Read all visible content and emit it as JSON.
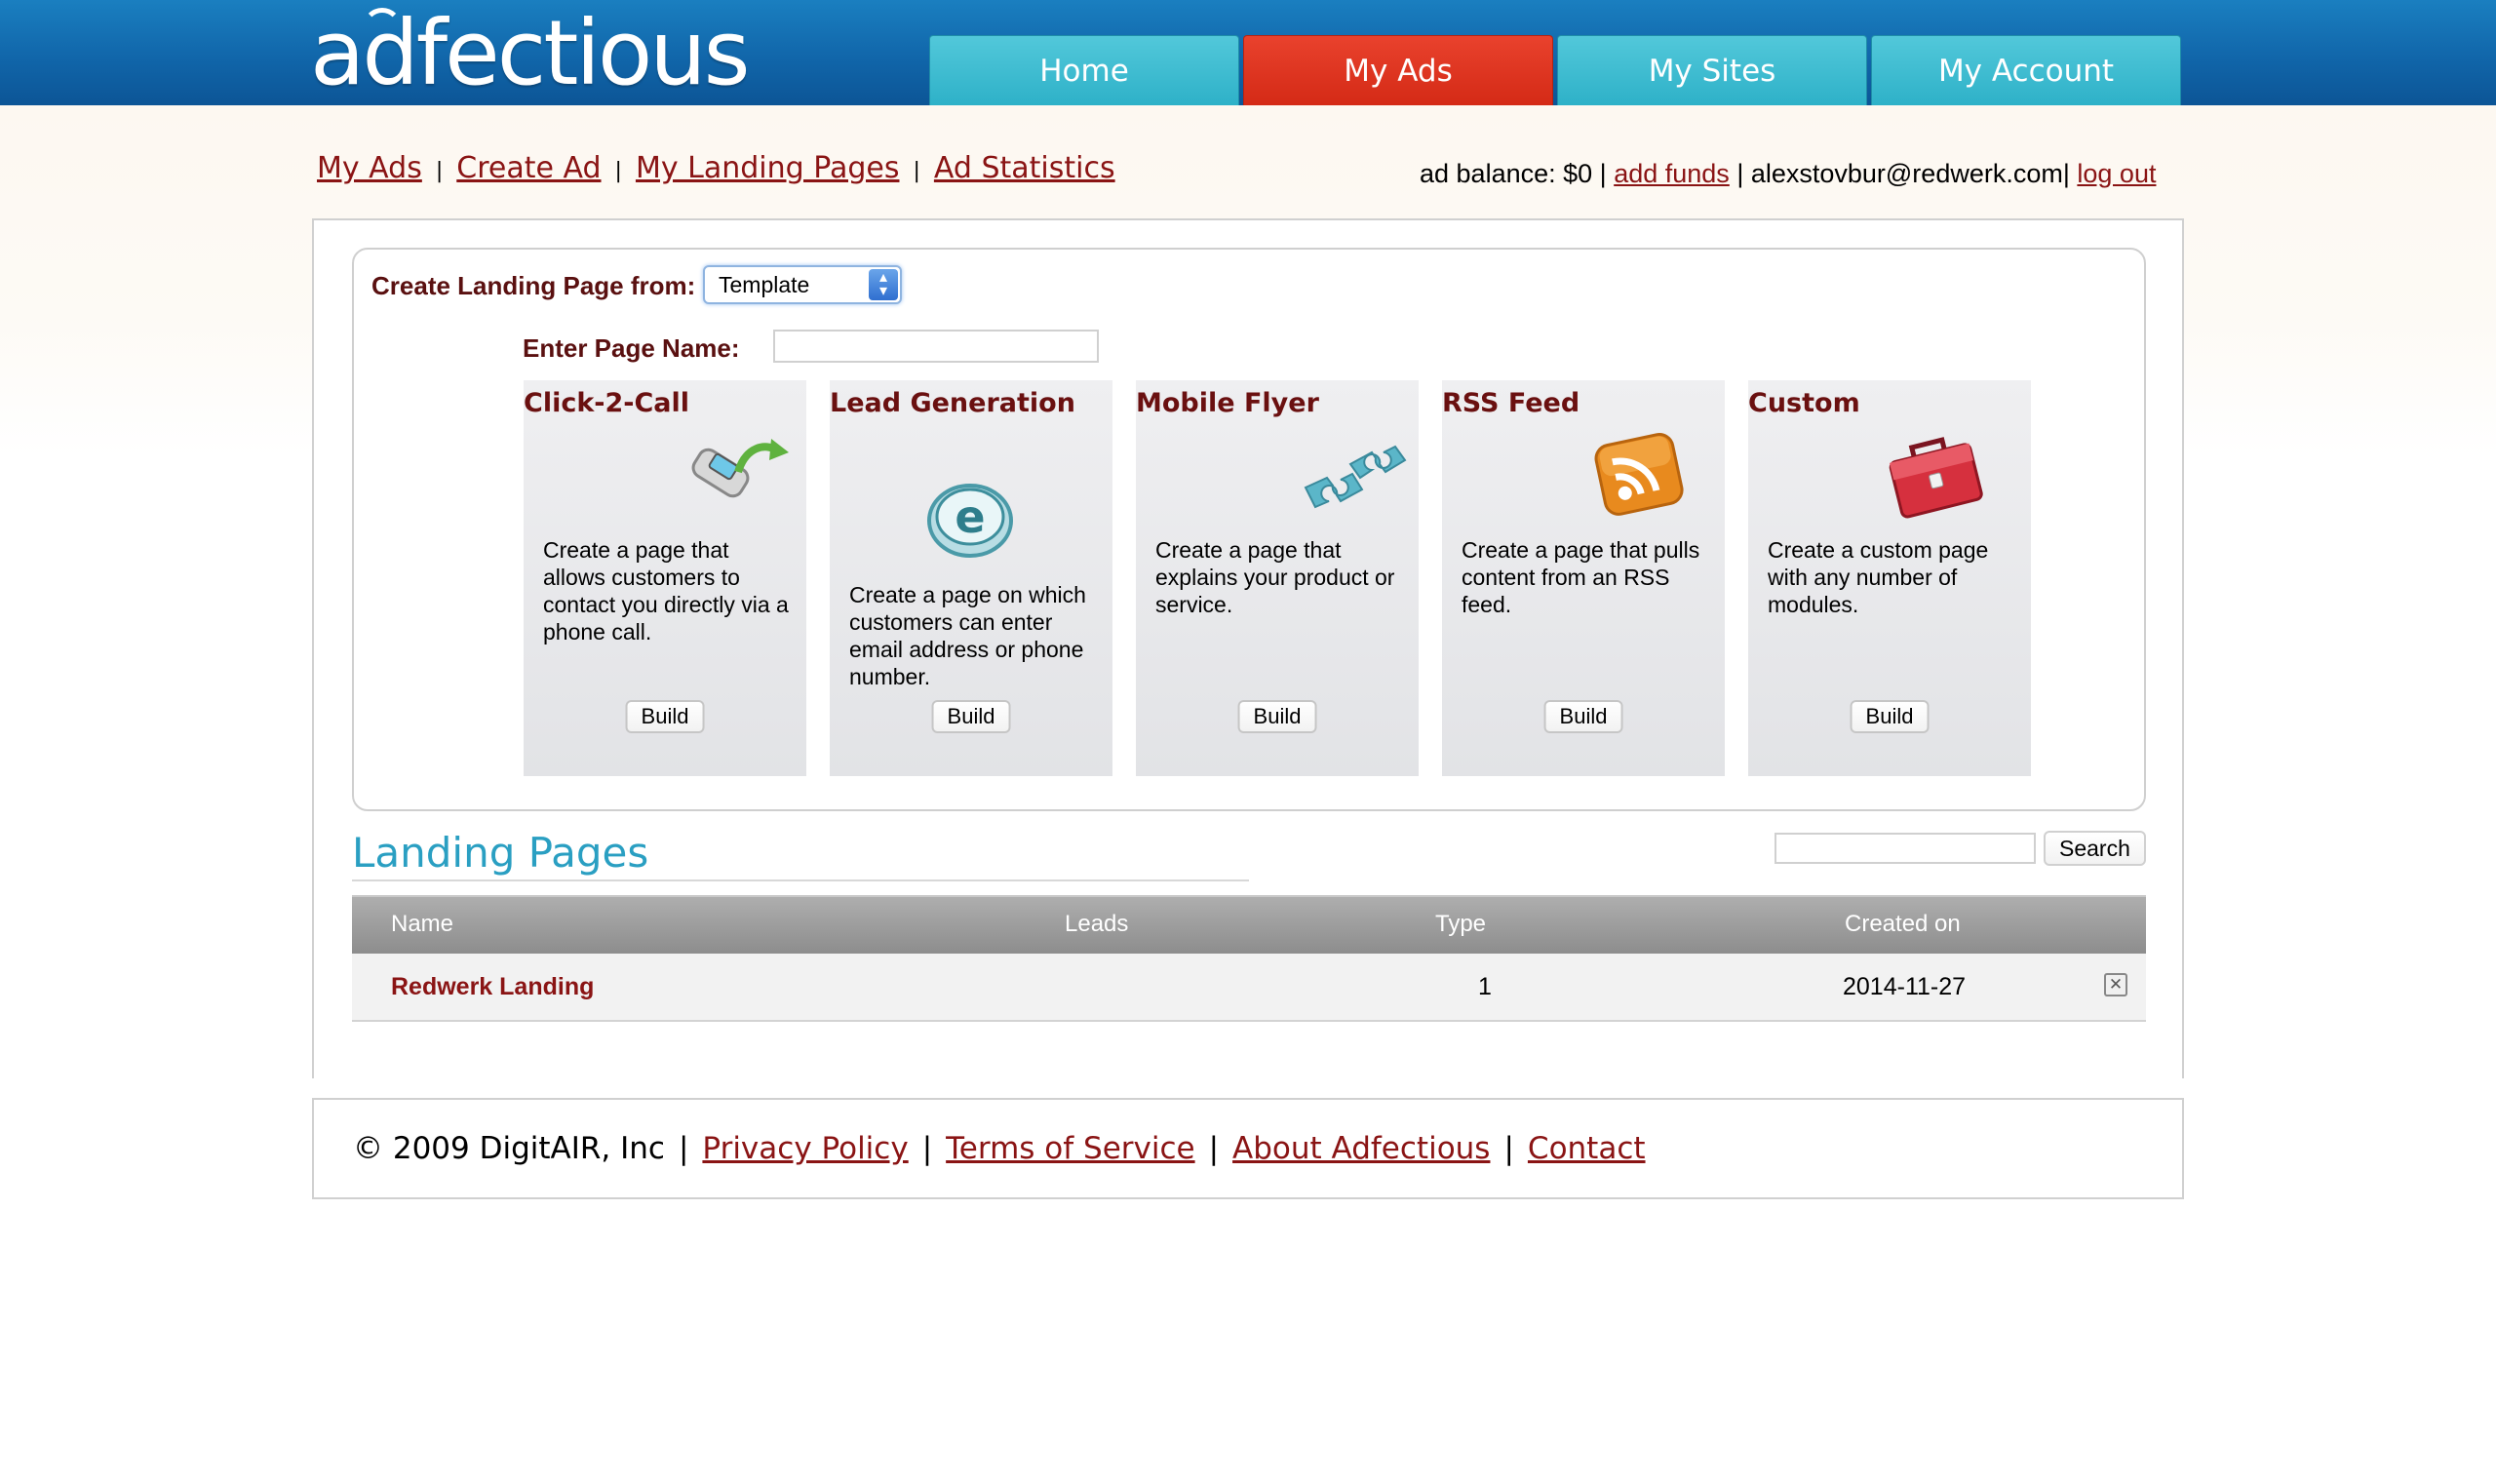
{
  "brand": {
    "logo_text": "adfectious"
  },
  "nav": {
    "tabs": [
      {
        "label": "Home"
      },
      {
        "label": "My Ads"
      },
      {
        "label": "My Sites"
      },
      {
        "label": "My Account"
      }
    ],
    "active_tab": "My Ads"
  },
  "subnav": {
    "links": [
      {
        "label": "My Ads"
      },
      {
        "label": "Create Ad"
      },
      {
        "label": "My Landing Pages "
      },
      {
        "label": "Ad Statistics"
      }
    ],
    "separator": "|"
  },
  "account": {
    "balance_text": "ad balance: $0 |",
    "add_funds": "add funds",
    "email_text": "| alexstovbur@redwerk.com|",
    "logout": "log out"
  },
  "create": {
    "from_label": "Create Landing Page from:",
    "from_value": "Template",
    "name_label": "Enter Page Name:",
    "name_value": ""
  },
  "templates": [
    {
      "title": "Click-2-Call",
      "icon": "phone-icon",
      "description": "Create a page that allows customers to contact you directly via a phone call.",
      "button": "Build"
    },
    {
      "title": "Lead Generation",
      "icon": "email-icon",
      "description": "Create a page on which customers can enter email address or phone number.",
      "button": "Build"
    },
    {
      "title": "Mobile Flyer",
      "icon": "puzzle-icon",
      "description": "Create a page that explains your product or service.",
      "button": "Build"
    },
    {
      "title": "RSS Feed",
      "icon": "rss-icon",
      "description": "Create a page that pulls content from an RSS feed.",
      "button": "Build"
    },
    {
      "title": "Custom",
      "icon": "toolbox-icon",
      "description": "Create a custom page with any number of modules.",
      "button": "Build"
    }
  ],
  "landing_pages": {
    "title": "Landing Pages",
    "search_value": "",
    "search_button": "Search",
    "columns": [
      "Name",
      "Leads",
      "Type",
      "Created on"
    ],
    "rows": [
      {
        "name": "Redwerk Landing",
        "leads": "",
        "type": "1",
        "created": "2014-11-27"
      }
    ]
  },
  "footer": {
    "copyright": "© 2009 DigitAIR, Inc",
    "links": [
      "Privacy Policy",
      "Terms of Service",
      "About Adfectious",
      "Contact"
    ],
    "separator": "|"
  },
  "colors": {
    "header": "#1166aa",
    "tab": "#2eb1c8",
    "tab_active": "#d42a16",
    "link": "#8a1414",
    "section_title": "#2a9fc2"
  }
}
